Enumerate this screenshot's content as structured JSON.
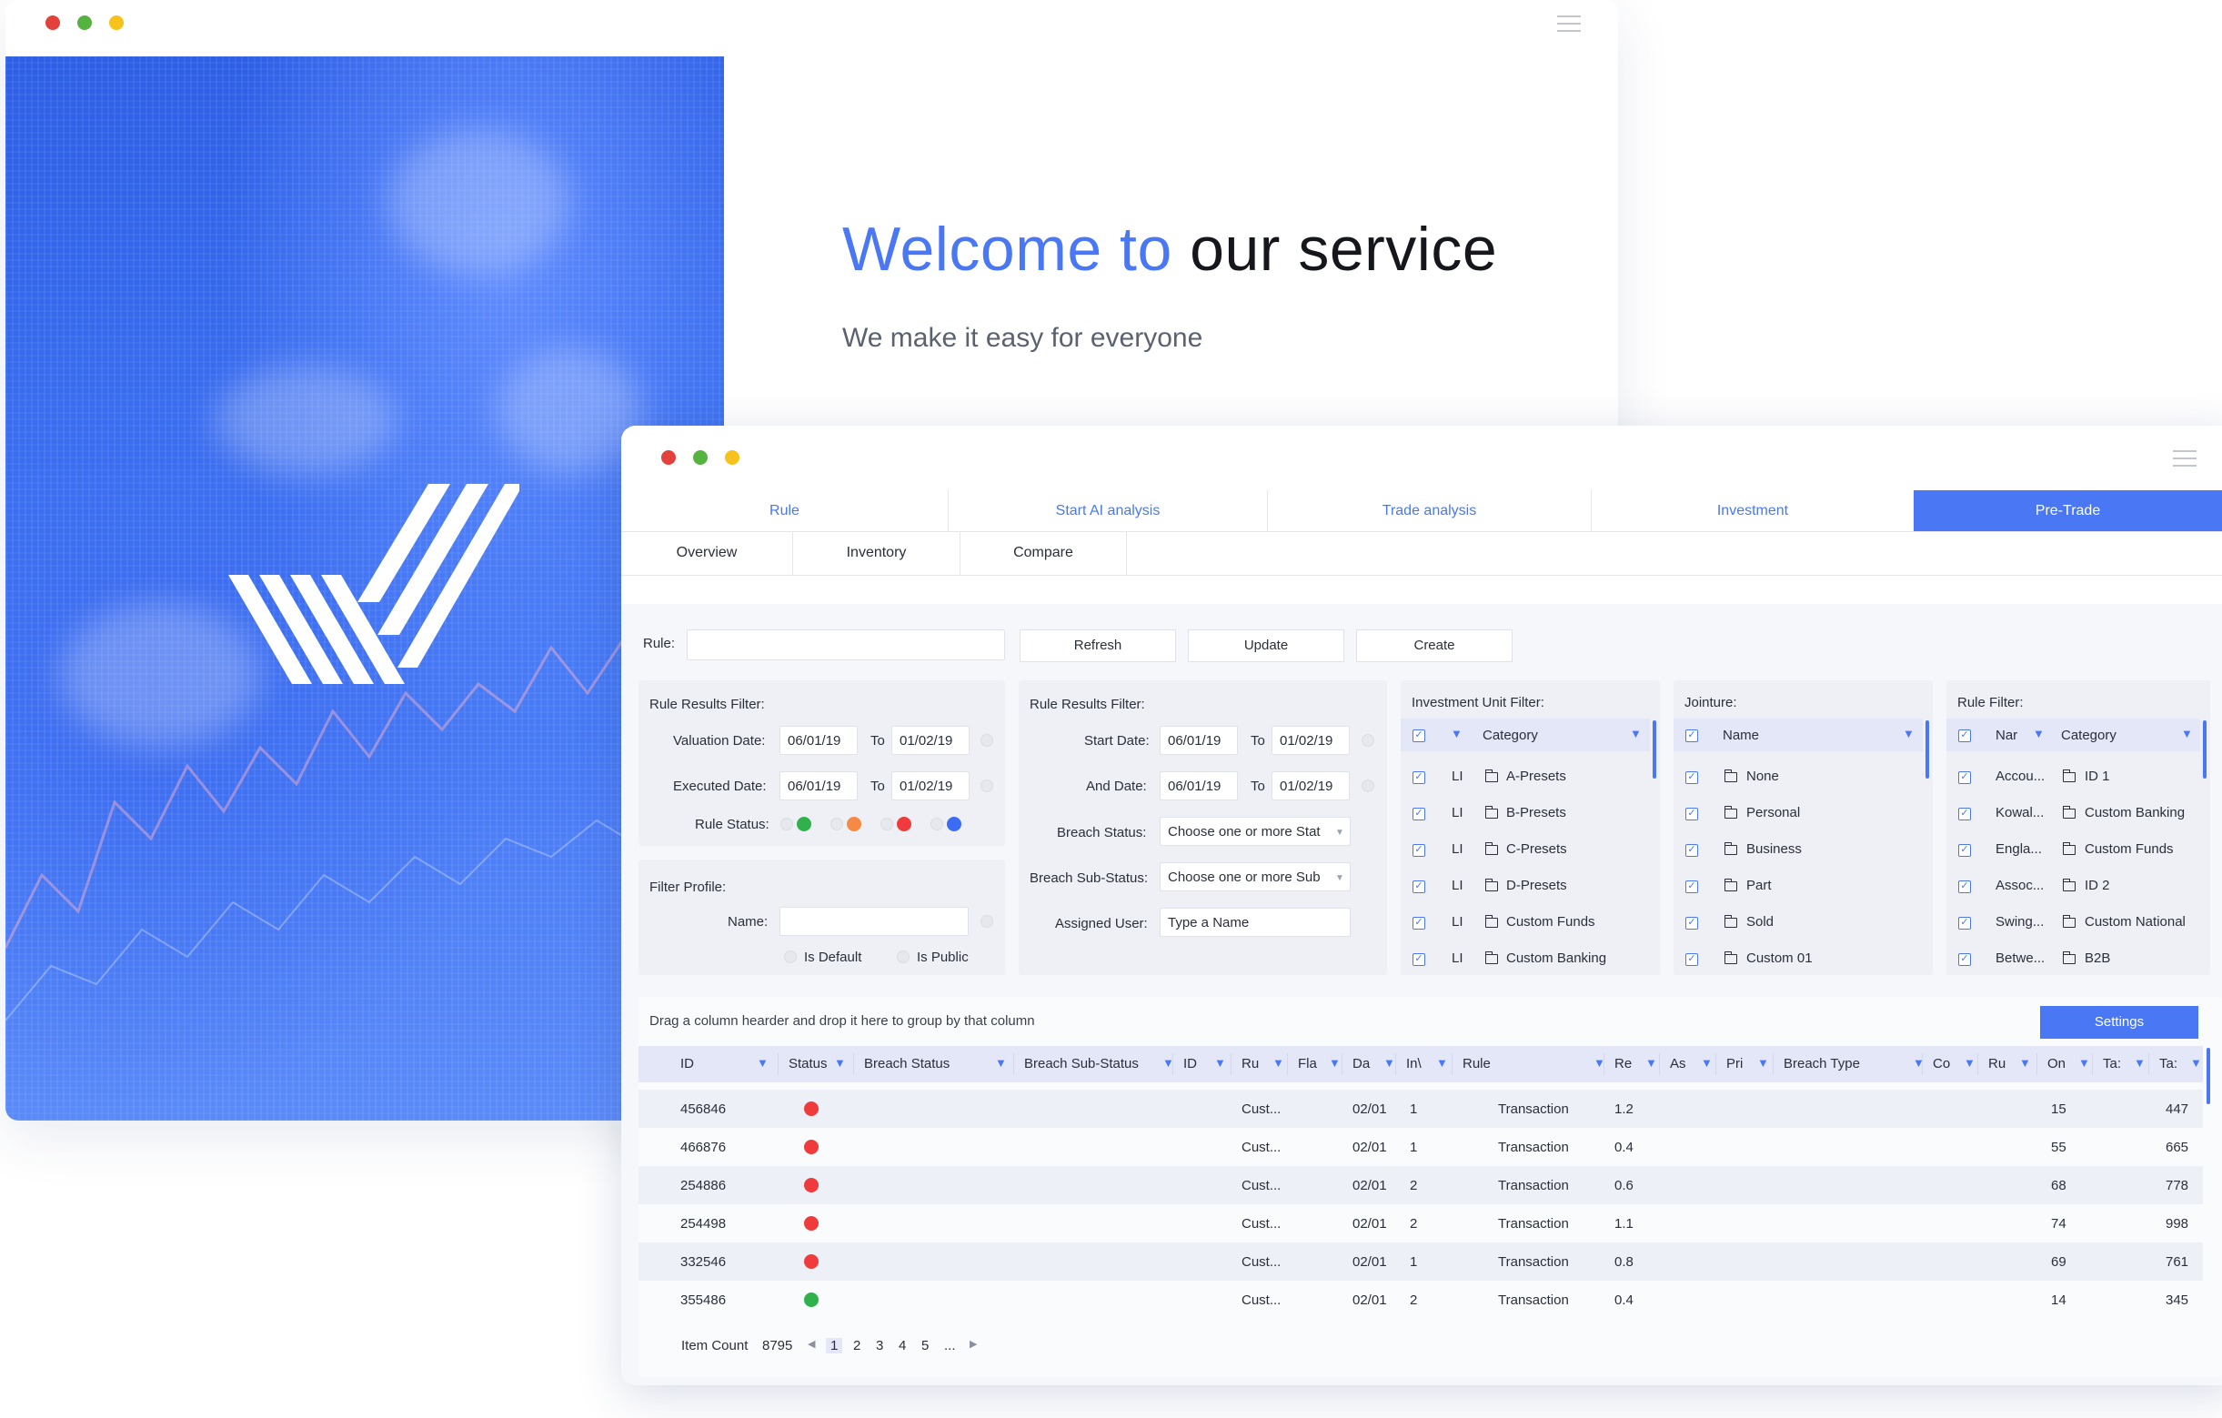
{
  "welcome": {
    "title_blue": "Welcome to",
    "title_dark": "our service",
    "subtitle": "We make it easy for everyone"
  },
  "colors": {
    "accent": "#4a78f5",
    "status_red": "#ef3b3b",
    "status_orange": "#f68a45",
    "status_green": "#2fb24c",
    "status_blue": "#3a6cf4"
  },
  "tabs_top": [
    "Rule",
    "Start AI analysis",
    "Trade analysis",
    "Investment",
    "Pre-Trade"
  ],
  "tabs_sub": [
    "Overview",
    "Inventory",
    "Compare"
  ],
  "toolbar": {
    "rule_label": "Rule:",
    "rule_value": "",
    "refresh": "Refresh",
    "update": "Update",
    "create": "Create"
  },
  "filter1": {
    "title": "Rule Results Filter:",
    "valuation_label": "Valuation Date:",
    "valuation_from": "06/01/19",
    "valuation_to": "01/02/19",
    "executed_label": "Executed Date:",
    "executed_from": "06/01/19",
    "executed_to": "01/02/19",
    "to": "To",
    "status_label": "Rule Status:"
  },
  "profile": {
    "title": "Filter Profile:",
    "name_label": "Name:",
    "name_value": "",
    "is_default": "Is Default",
    "is_public": "Is Public"
  },
  "filter2": {
    "title": "Rule Results Filter:",
    "start_label": "Start Date:",
    "start_from": "06/01/19",
    "start_to": "01/02/19",
    "and_label": "And Date:",
    "and_from": "06/01/19",
    "and_to": "01/02/19",
    "to": "To",
    "breach_label": "Breach Status:",
    "breach_placeholder": "Choose one or more Stat",
    "sub_label": "Breach Sub-Status:",
    "sub_placeholder": "Choose one or more Sub",
    "user_label": "Assigned User:",
    "user_placeholder": "Type a Name"
  },
  "investment_filter": {
    "title": "Investment Unit Filter:",
    "header": "Category",
    "items": [
      {
        "code": "LI",
        "name": "A-Presets"
      },
      {
        "code": "LI",
        "name": "B-Presets"
      },
      {
        "code": "LI",
        "name": "C-Presets"
      },
      {
        "code": "LI",
        "name": "D-Presets"
      },
      {
        "code": "LI",
        "name": "Custom Funds"
      },
      {
        "code": "LI",
        "name": "Custom Banking"
      }
    ]
  },
  "jointure": {
    "title": "Jointure:",
    "header": "Name",
    "items": [
      "None",
      "Personal",
      "Business",
      "Part",
      "Sold",
      "Custom 01"
    ]
  },
  "rule_filter": {
    "title": "Rule Filter:",
    "header_name": "Nar",
    "header_category": "Category",
    "items": [
      {
        "name": "Accou...",
        "category": "ID 1"
      },
      {
        "name": "Kowal...",
        "category": "Custom Banking"
      },
      {
        "name": "Engla...",
        "category": "Custom Funds"
      },
      {
        "name": "Assoc...",
        "category": "ID 2"
      },
      {
        "name": "Swing...",
        "category": "Custom National"
      },
      {
        "name": "Betwe...",
        "category": "B2B"
      }
    ]
  },
  "grid": {
    "group_hint": "Drag a column hearder and drop it here to group by that column",
    "settings": "Settings",
    "columns": [
      "ID",
      "Status",
      "Breach Status",
      "Breach Sub-Status",
      "ID",
      "Ru",
      "Fla",
      "Da",
      "In\\",
      "Rule",
      "Re",
      "As",
      "Pri",
      "Breach Type",
      "Co",
      "Ru",
      "On",
      "Ta:",
      "Ta:"
    ],
    "rows": [
      {
        "id": "456846",
        "status": "red",
        "ru": "Cust...",
        "da": "02/01",
        "in": "1",
        "rule": "Transaction",
        "re": "1.2",
        "on": "15",
        "ta": "447"
      },
      {
        "id": "466876",
        "status": "red",
        "ru": "Cust...",
        "da": "02/01",
        "in": "1",
        "rule": "Transaction",
        "re": "0.4",
        "on": "55",
        "ta": "665"
      },
      {
        "id": "254886",
        "status": "red",
        "ru": "Cust...",
        "da": "02/01",
        "in": "2",
        "rule": "Transaction",
        "re": "0.6",
        "on": "68",
        "ta": "778"
      },
      {
        "id": "254498",
        "status": "red",
        "ru": "Cust...",
        "da": "02/01",
        "in": "2",
        "rule": "Transaction",
        "re": "1.1",
        "on": "74",
        "ta": "998"
      },
      {
        "id": "332546",
        "status": "red",
        "ru": "Cust...",
        "da": "02/01",
        "in": "1",
        "rule": "Transaction",
        "re": "0.8",
        "on": "69",
        "ta": "761"
      },
      {
        "id": "355486",
        "status": "green",
        "ru": "Cust...",
        "da": "02/01",
        "in": "2",
        "rule": "Transaction",
        "re": "0.4",
        "on": "14",
        "ta": "345"
      }
    ],
    "item_count_label": "Item Count",
    "item_count": "8795",
    "pages": [
      "1",
      "2",
      "3",
      "4",
      "5",
      "..."
    ],
    "prev_icon": "chevron-left-icon",
    "next_icon": "chevron-right-icon"
  }
}
